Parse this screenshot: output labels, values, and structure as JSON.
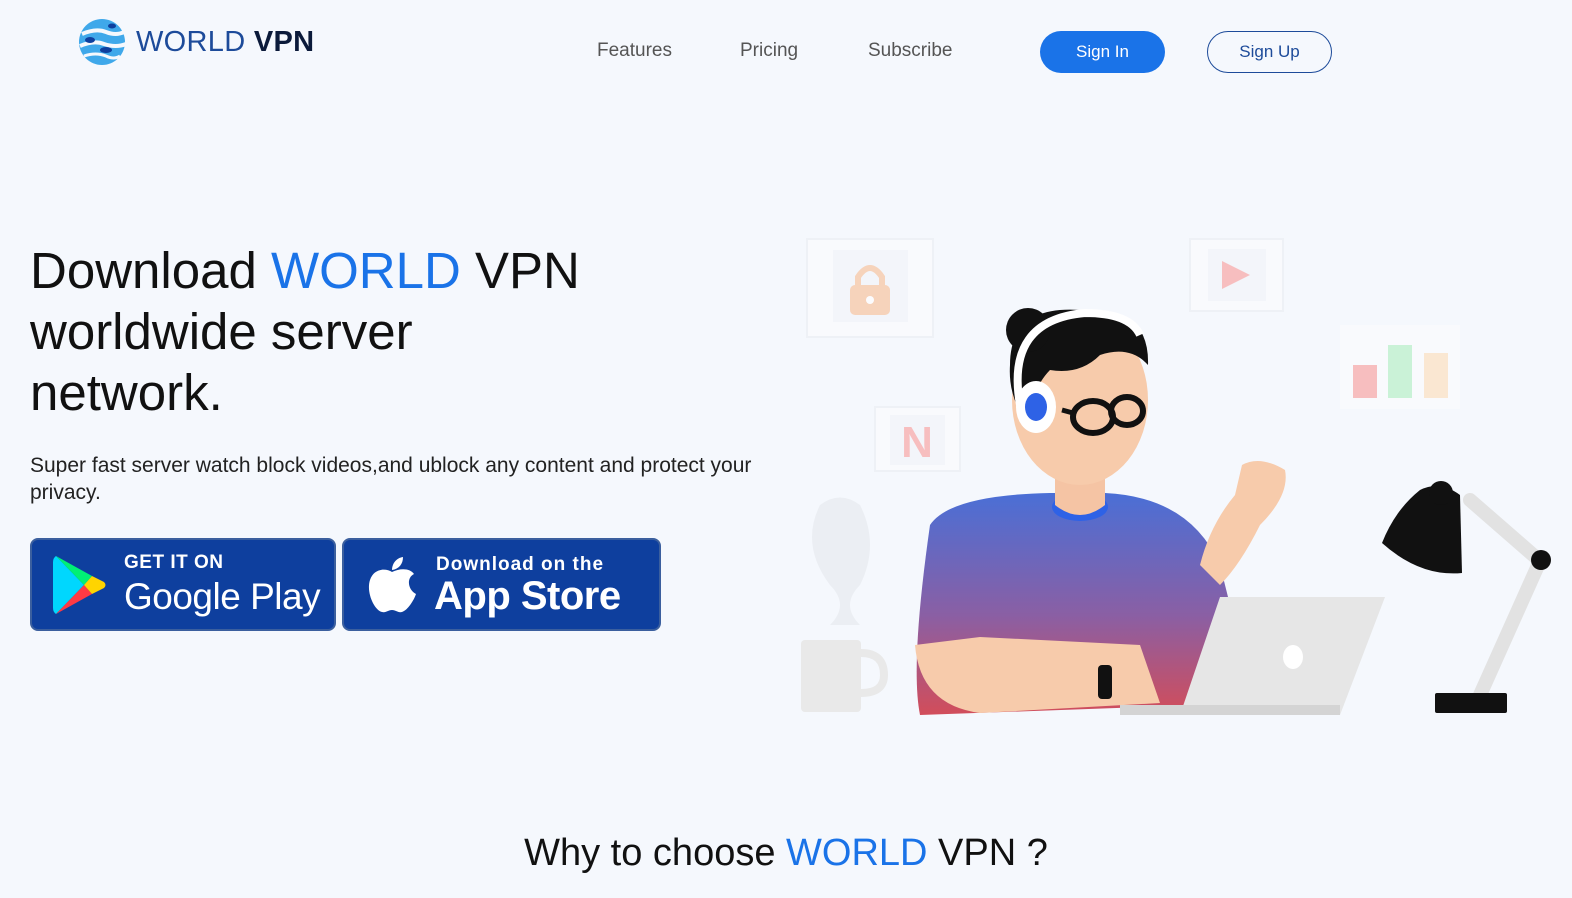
{
  "brand": {
    "name_part1": "WORLD ",
    "name_part2": "VPN"
  },
  "nav": {
    "items": [
      {
        "label": "Features"
      },
      {
        "label": "Pricing"
      },
      {
        "label": "Subscribe"
      }
    ],
    "sign_in": "Sign In",
    "sign_up": "Sign Up"
  },
  "hero": {
    "title_part1": "Download ",
    "title_accent": "WORLD",
    "title_part2": " VPN",
    "title_line2": "worldwide server",
    "title_line3": "network.",
    "subtitle": "Super fast server watch block videos,and ublock any content and protect your privacy.",
    "google_play": {
      "small": "GET IT ON",
      "big": "Google Play"
    },
    "app_store": {
      "small": "Download on the",
      "big": "App Store"
    }
  },
  "why": {
    "part1": "Why to choose ",
    "accent": "WORLD",
    "part2": " VPN ?"
  },
  "colors": {
    "accent": "#1a73e8",
    "background": "#f5f8fd",
    "store_badge": "#0e3f9e"
  }
}
